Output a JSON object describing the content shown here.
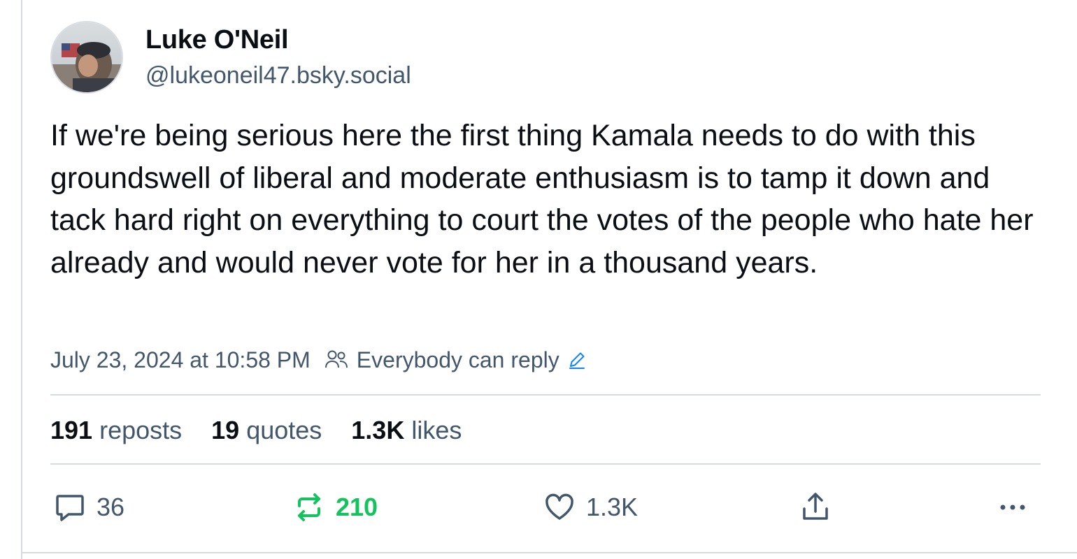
{
  "author": {
    "display_name": "Luke O'Neil",
    "handle": "@lukeoneil47.bsky.social"
  },
  "post": {
    "text": "If we're being serious here the first thing Kamala needs to do with this groundswell of liberal and moderate enthusiasm is to tamp it down and tack hard right on everything to court the votes of the people who hate her already and would never vote for her in a thousand years.",
    "timestamp": "July 23, 2024 at 10:58 PM",
    "reply_setting": "Everybody can reply"
  },
  "stats": {
    "reposts_count": "191",
    "reposts_label": "reposts",
    "quotes_count": "19",
    "quotes_label": "quotes",
    "likes_count": "1.3K",
    "likes_label": "likes"
  },
  "actions": {
    "reply_count": "36",
    "repost_count": "210",
    "like_count": "1.3K",
    "more_label": "..."
  },
  "icons": {
    "reply": "speech-bubble-icon",
    "repost": "repost-arrows-icon",
    "like": "heart-icon",
    "share": "share-upload-icon",
    "more": "more-dots-icon",
    "people": "people-icon",
    "edit": "pencil-icon"
  },
  "colors": {
    "text_primary": "#0b0f14",
    "text_secondary": "#42576c",
    "repost_active": "#13c35e",
    "link_blue": "#1083fe",
    "divider": "#d4dbe2"
  }
}
